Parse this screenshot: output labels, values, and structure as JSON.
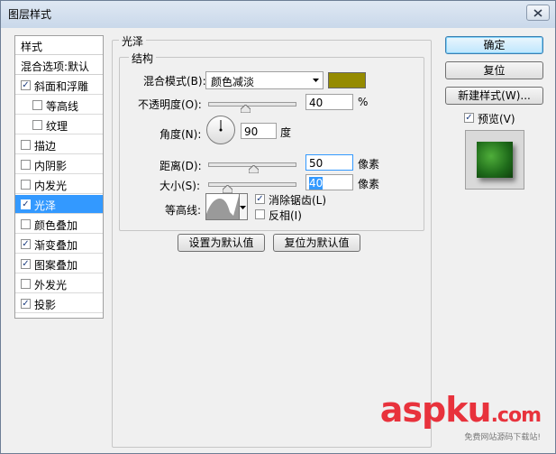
{
  "window": {
    "title": "图层样式"
  },
  "styles_panel": {
    "header": "样式",
    "blend_options": "混合选项:默认",
    "items": [
      {
        "label": "斜面和浮雕",
        "checked": true,
        "indent": false,
        "selected": false
      },
      {
        "label": "等高线",
        "checked": false,
        "indent": true,
        "selected": false
      },
      {
        "label": "纹理",
        "checked": false,
        "indent": true,
        "selected": false
      },
      {
        "label": "描边",
        "checked": false,
        "indent": false,
        "selected": false
      },
      {
        "label": "内阴影",
        "checked": false,
        "indent": false,
        "selected": false
      },
      {
        "label": "内发光",
        "checked": false,
        "indent": false,
        "selected": false
      },
      {
        "label": "光泽",
        "checked": true,
        "indent": false,
        "selected": true
      },
      {
        "label": "颜色叠加",
        "checked": false,
        "indent": false,
        "selected": false
      },
      {
        "label": "渐变叠加",
        "checked": true,
        "indent": false,
        "selected": false
      },
      {
        "label": "图案叠加",
        "checked": true,
        "indent": false,
        "selected": false
      },
      {
        "label": "外发光",
        "checked": false,
        "indent": false,
        "selected": false
      },
      {
        "label": "投影",
        "checked": true,
        "indent": false,
        "selected": false
      }
    ]
  },
  "satin": {
    "group_title": "光泽",
    "structure_title": "结构",
    "blend_mode_label": "混合模式(B):",
    "blend_mode_value": "颜色减淡",
    "color": "#958b00",
    "opacity_label": "不透明度(O):",
    "opacity_value": "40",
    "opacity_unit": "%",
    "opacity_fraction": 0.4,
    "angle_label": "角度(N):",
    "angle_value": "90",
    "angle_unit": "度",
    "distance_label": "距离(D):",
    "distance_value": "50",
    "distance_unit": "像素",
    "size_label": "大小(S):",
    "size_value": "40",
    "size_unit": "像素",
    "contour_label": "等高线:",
    "antialias_label": "消除锯齿(L)",
    "antialias_checked": true,
    "invert_label": "反相(I)",
    "invert_checked": false,
    "make_default": "设置为默认值",
    "reset_default": "复位为默认值"
  },
  "buttons": {
    "ok": "确定",
    "reset": "复位",
    "new_style": "新建样式(W)...",
    "preview_label": "预览(V)",
    "preview_checked": true
  },
  "watermark": {
    "brand": "aspku",
    "tld": ".com",
    "tagline": "免费网站源码下载站!"
  }
}
